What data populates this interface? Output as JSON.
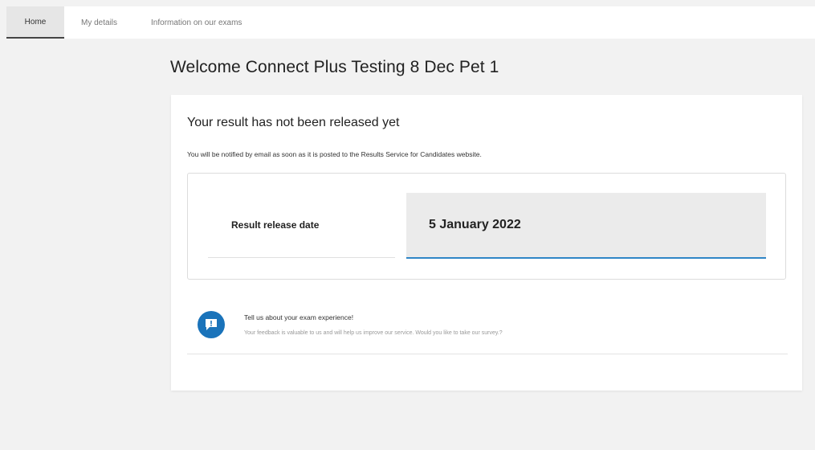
{
  "nav": {
    "tabs": [
      {
        "label": "Home",
        "active": true
      },
      {
        "label": "My details",
        "active": false
      },
      {
        "label": "Information on our exams",
        "active": false
      }
    ]
  },
  "page": {
    "title": "Welcome Connect Plus Testing 8 Dec Pet 1"
  },
  "result": {
    "heading": "Your result has not been released yet",
    "subtext": "You will be notified by email as soon as it is posted to the Results Service for Candidates website.",
    "release_label": "Result release date",
    "release_date": "5 January 2022"
  },
  "feedback": {
    "icon": "feedback-bubble-icon",
    "title": "Tell us about your exam experience!",
    "text": "Your feedback is valuable to us and will help us improve our service. Would you like to take our survey.?"
  },
  "colors": {
    "accent": "#1a73ba",
    "underline": "#2f86c6",
    "background": "#f2f2f2"
  }
}
